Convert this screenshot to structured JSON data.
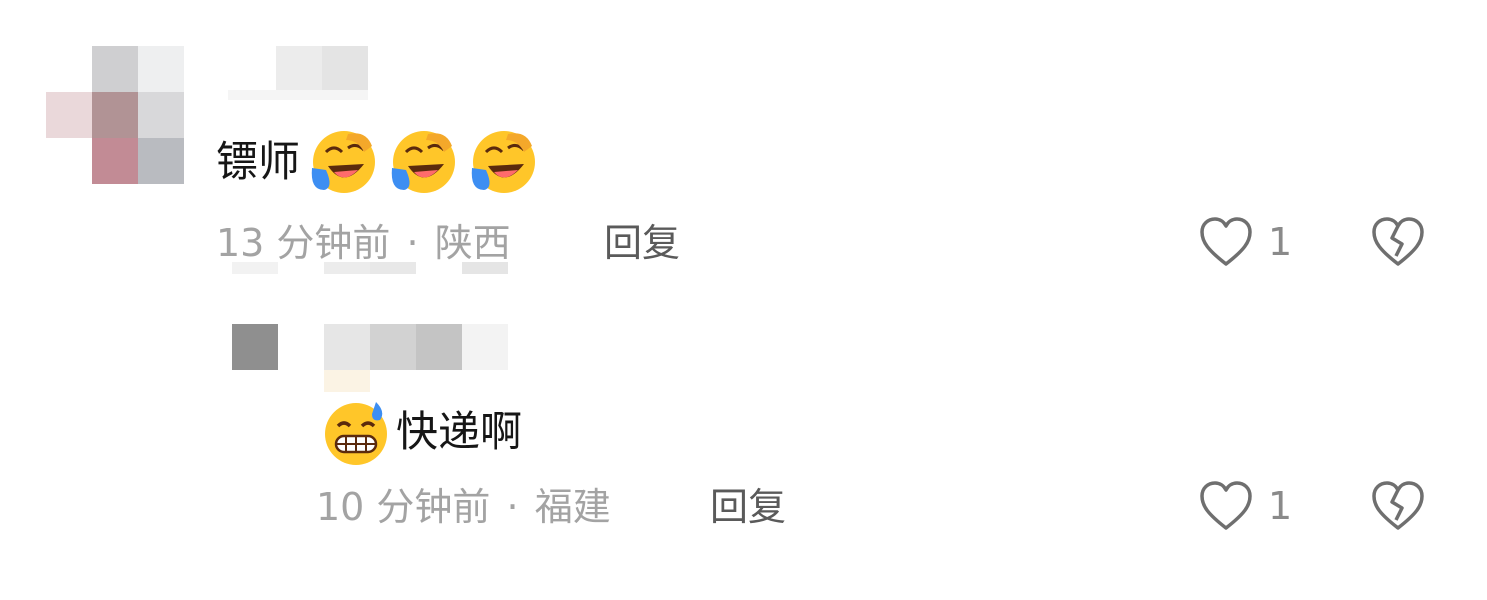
{
  "comments": [
    {
      "text": "镖师",
      "emoji": [
        "rofl-cry-emoji",
        "rofl-cry-emoji",
        "rofl-cry-emoji"
      ],
      "time": "13 分钟前",
      "separator": "·",
      "location": "陕西",
      "reply_label": "回复",
      "likes": "1"
    },
    {
      "text": "快递啊",
      "emoji": [
        "grin-sweat-emoji"
      ],
      "time": "10 分钟前",
      "separator": "·",
      "location": "福建",
      "reply_label": "回复",
      "likes": "1"
    }
  ],
  "colors": {
    "meta": "#a3a3a3",
    "reply": "#5a5a5a",
    "icon": "#6f6f6f",
    "emoji_yellow": "#ffc629",
    "emoji_tear": "#3d8ef2"
  },
  "icons": {
    "like": "heart-outline-icon",
    "dislike": "broken-heart-icon"
  }
}
